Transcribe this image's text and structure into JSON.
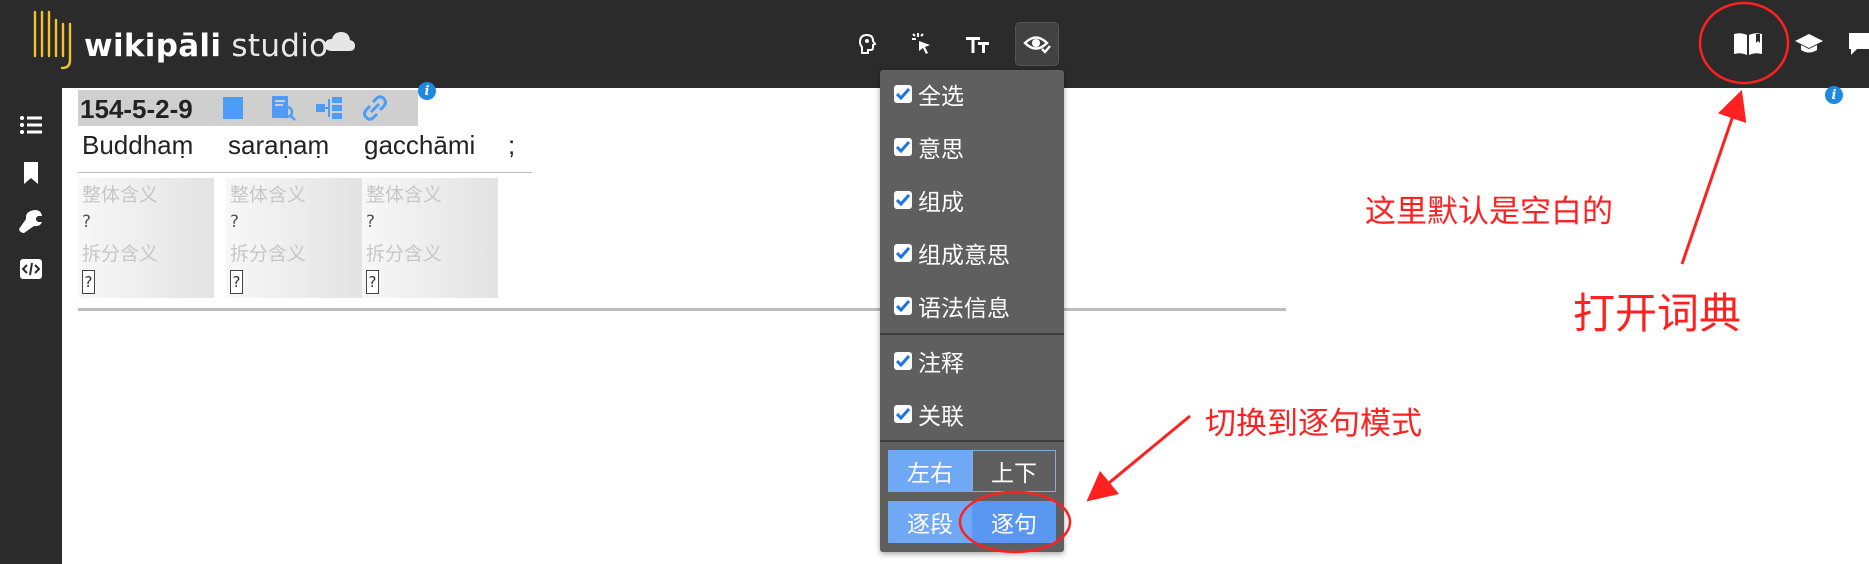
{
  "app": {
    "logo_bold": "wikipāli",
    "logo_light": " studio",
    "cloud_icon": "cloud-icon"
  },
  "toolbar": {
    "tools": [
      {
        "name": "brain-hint-icon"
      },
      {
        "name": "pointer-click-icon"
      },
      {
        "name": "text-size-icon"
      },
      {
        "name": "eye-view-icon",
        "active": true
      }
    ],
    "right": [
      {
        "name": "open-book-icon"
      },
      {
        "name": "graduation-cap-icon"
      },
      {
        "name": "chat-icon"
      }
    ]
  },
  "sidebar": {
    "items": [
      {
        "name": "list-icon"
      },
      {
        "name": "bookmark-icon"
      },
      {
        "name": "wrench-icon"
      },
      {
        "name": "code-icon"
      }
    ]
  },
  "sentence": {
    "id": "154-5-2-9",
    "words": [
      "Buddhaṃ",
      "saraṇaṃ",
      "gacchāmi",
      ";"
    ],
    "cards": [
      {
        "meaning": "整体含义",
        "q1": "?",
        "split": "拆分含义",
        "box": "?"
      },
      {
        "meaning": "整体含义",
        "q1": "?",
        "split": "拆分含义",
        "box": "?"
      },
      {
        "meaning": "整体含义",
        "q1": "?",
        "split": "拆分含义",
        "box": "?"
      }
    ],
    "info": "i"
  },
  "dropdown": {
    "items": [
      "全选",
      "意思",
      "组成",
      "组成意思",
      "语法信息"
    ],
    "items2": [
      "注释",
      "关联"
    ],
    "layout": {
      "left_right": "左右",
      "top_bottom": "上下"
    },
    "mode": {
      "paragraph": "逐段",
      "sentence": "逐句"
    }
  },
  "annotations": {
    "empty_default": "这里默认是空白的",
    "open_dict": "打开词典",
    "switch_mode": "切换到逐句模式"
  },
  "colors": {
    "header_bg": "#2b2b2b",
    "accent_yellow": "#f2c230",
    "accent_blue": "#6fa8f5",
    "annotation_red": "#ff2020"
  }
}
